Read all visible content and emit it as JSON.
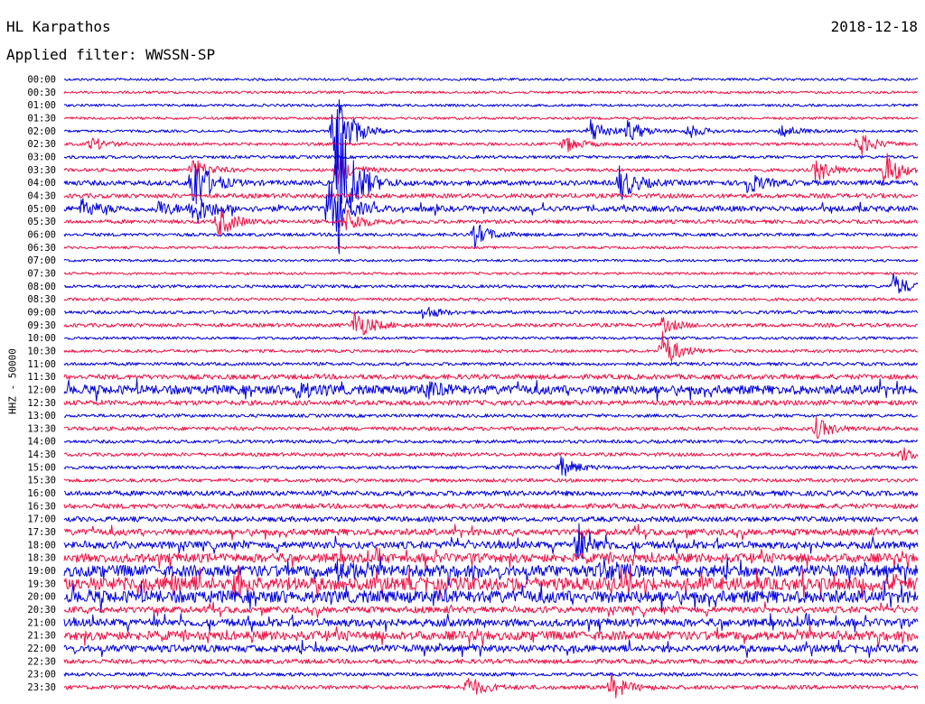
{
  "header": {
    "station": "HL Karpathos",
    "date": "2018-12-18",
    "filter": "Applied filter: WWSSN-SP"
  },
  "colors": {
    "even_trace": "#0000dd",
    "odd_trace": "#ee1144"
  },
  "chart_data": {
    "type": "line",
    "title": "HL Karpathos",
    "subtitle": "Applied filter: WWSSN-SP",
    "ylabel": "HHZ - 50000",
    "xlabel": "",
    "grid": false,
    "legend": "none",
    "categories": [
      "00:00",
      "00:30",
      "01:00",
      "01:30",
      "02:00",
      "02:30",
      "03:00",
      "03:30",
      "04:00",
      "04:30",
      "05:00",
      "05:30",
      "06:00",
      "06:30",
      "07:00",
      "07:30",
      "08:00",
      "08:30",
      "09:00",
      "09:30",
      "10:00",
      "10:30",
      "11:00",
      "11:30",
      "12:00",
      "12:30",
      "13:00",
      "13:30",
      "14:00",
      "14:30",
      "15:00",
      "15:30",
      "16:00",
      "16:30",
      "17:00",
      "17:30",
      "18:00",
      "18:30",
      "19:00",
      "19:30",
      "20:00",
      "20:30",
      "21:00",
      "21:30",
      "22:00",
      "22:30",
      "23:00",
      "23:30"
    ],
    "noise_level": [
      1.0,
      1.0,
      1.0,
      1.0,
      1.0,
      1.2,
      1.2,
      1.3,
      2.0,
      1.8,
      2.2,
      1.5,
      1.3,
      1.0,
      1.0,
      1.0,
      1.2,
      1.2,
      1.3,
      1.5,
      1.1,
      1.2,
      1.3,
      2.0,
      3.5,
      2.0,
      1.3,
      1.5,
      1.3,
      1.4,
      1.3,
      1.4,
      2.0,
      2.0,
      2.0,
      2.5,
      2.8,
      3.5,
      4.5,
      5.0,
      4.8,
      2.5,
      3.0,
      3.5,
      2.8,
      1.8,
      1.4,
      1.6
    ],
    "events": [
      {
        "row": 4,
        "t": 0.315,
        "amp": 60
      },
      {
        "row": 4,
        "t": 0.615,
        "amp": 16
      },
      {
        "row": 4,
        "t": 0.66,
        "amp": 12
      },
      {
        "row": 4,
        "t": 0.73,
        "amp": 8
      },
      {
        "row": 4,
        "t": 0.84,
        "amp": 8
      },
      {
        "row": 5,
        "t": 0.03,
        "amp": 8
      },
      {
        "row": 5,
        "t": 0.585,
        "amp": 10
      },
      {
        "row": 5,
        "t": 0.93,
        "amp": 14
      },
      {
        "row": 7,
        "t": 0.15,
        "amp": 14
      },
      {
        "row": 7,
        "t": 0.32,
        "amp": 16
      },
      {
        "row": 7,
        "t": 0.88,
        "amp": 14
      },
      {
        "row": 7,
        "t": 0.96,
        "amp": 22
      },
      {
        "row": 8,
        "t": 0.15,
        "amp": 36
      },
      {
        "row": 8,
        "t": 0.32,
        "amp": 90
      },
      {
        "row": 8,
        "t": 0.65,
        "amp": 20
      },
      {
        "row": 8,
        "t": 0.8,
        "amp": 12
      },
      {
        "row": 10,
        "t": 0.02,
        "amp": 10
      },
      {
        "row": 10,
        "t": 0.11,
        "amp": 8
      },
      {
        "row": 10,
        "t": 0.15,
        "amp": 20
      },
      {
        "row": 10,
        "t": 0.31,
        "amp": 40
      },
      {
        "row": 11,
        "t": 0.18,
        "amp": 18
      },
      {
        "row": 11,
        "t": 0.33,
        "amp": 14
      },
      {
        "row": 12,
        "t": 0.48,
        "amp": 14
      },
      {
        "row": 16,
        "t": 0.97,
        "amp": 14
      },
      {
        "row": 18,
        "t": 0.42,
        "amp": 8
      },
      {
        "row": 19,
        "t": 0.34,
        "amp": 18
      },
      {
        "row": 19,
        "t": 0.7,
        "amp": 8
      },
      {
        "row": 21,
        "t": 0.7,
        "amp": 22
      },
      {
        "row": 24,
        "t": 0.27,
        "amp": 10
      },
      {
        "row": 24,
        "t": 0.42,
        "amp": 8
      },
      {
        "row": 27,
        "t": 0.88,
        "amp": 12
      },
      {
        "row": 29,
        "t": 0.98,
        "amp": 8
      },
      {
        "row": 30,
        "t": 0.58,
        "amp": 12
      },
      {
        "row": 36,
        "t": 0.6,
        "amp": 18
      },
      {
        "row": 38,
        "t": 0.32,
        "amp": 10
      },
      {
        "row": 38,
        "t": 0.63,
        "amp": 10
      },
      {
        "row": 39,
        "t": 0.12,
        "amp": 10
      },
      {
        "row": 39,
        "t": 0.2,
        "amp": 10
      },
      {
        "row": 47,
        "t": 0.47,
        "amp": 14
      },
      {
        "row": 47,
        "t": 0.64,
        "amp": 14
      }
    ]
  }
}
